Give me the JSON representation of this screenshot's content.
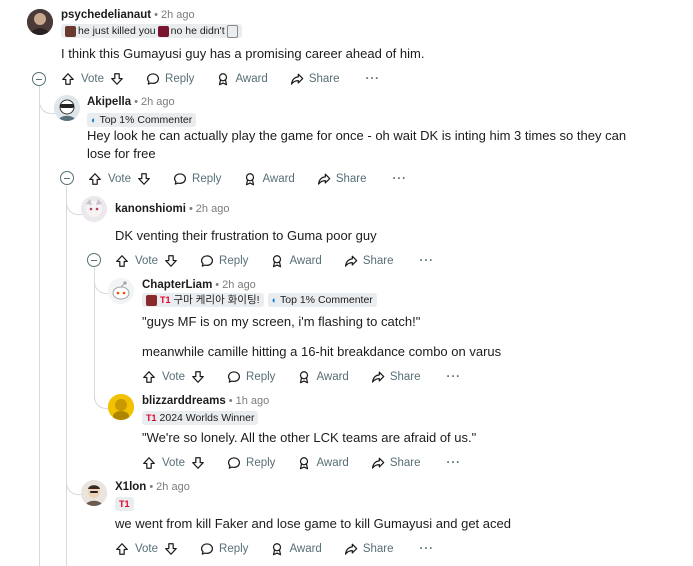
{
  "comments": [
    {
      "username": "psychedelianaut",
      "time": "2h ago",
      "flair_parts": [
        "he just killed you",
        "no he didn't"
      ],
      "body": [
        "I think this Gumayusi guy has a promising career ahead of him."
      ]
    },
    {
      "username": "Akipella",
      "time": "2h ago",
      "flair": "Top 1% Commenter",
      "body": [
        "Hey look he can actually play the game for once - oh wait DK is inting him 3 times so they can lose for free"
      ]
    },
    {
      "username": "kanonshiomi",
      "time": "2h ago",
      "body": [
        "DK venting their frustration to Guma poor guy"
      ]
    },
    {
      "username": "ChapterLiam",
      "time": "2h ago",
      "flair_parts": [
        "구마 케리아 화이팅!",
        "Top 1% Commenter"
      ],
      "body": [
        "\"guys MF is on my screen, i'm flashing to catch!\"",
        "meanwhile camille hitting a 16-hit breakdance combo on varus"
      ]
    },
    {
      "username": "blizzarddreams",
      "time": "1h ago",
      "flair": "2024 Worlds Winner",
      "body": [
        "\"We're so lonely. All the other LCK teams are afraid of us.\""
      ]
    },
    {
      "username": "X1lon",
      "time": "2h ago",
      "body": [
        "we went from kill Faker and lose game to kill Gumayusi and get aced"
      ]
    }
  ],
  "actions": {
    "vote": "Vote",
    "reply": "Reply",
    "award": "Award",
    "share": "Share",
    "more": "···"
  },
  "icons": [
    "upvote-icon",
    "downvote-icon",
    "reply-icon",
    "award-icon",
    "share-icon",
    "more-icon",
    "collapse-icon"
  ],
  "colors": {
    "t1_red": "#e2012d",
    "meta_gray": "#7c7c7c",
    "flair_bg": "#eaedef",
    "thread_line": "#d7dadc"
  }
}
